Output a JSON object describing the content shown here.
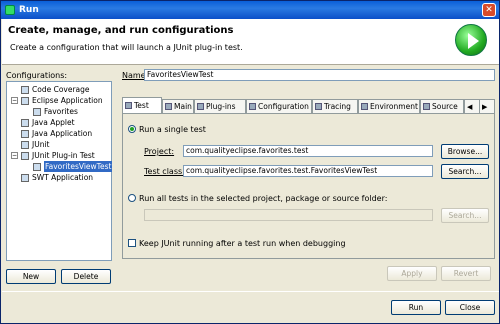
{
  "window": {
    "title": "Run"
  },
  "banner": {
    "heading": "Create, manage, and run configurations",
    "subtitle": "Create a configuration that will launch a JUnit plug-in test."
  },
  "left": {
    "label": "Configurations:",
    "tree": [
      {
        "label": "Code Coverage",
        "icon": "coverage-icon"
      },
      {
        "label": "Eclipse Application",
        "icon": "eclipse-icon"
      },
      {
        "label": "Favorites",
        "icon": "run-config-icon"
      },
      {
        "label": "Java Applet",
        "icon": "applet-icon"
      },
      {
        "label": "Java Application",
        "icon": "java-app-icon"
      },
      {
        "label": "JUnit",
        "icon": "junit-icon"
      },
      {
        "label": "JUnit Plug-in Test",
        "icon": "junit-plugin-icon"
      },
      {
        "label": "FavoritesViewTest",
        "icon": "junit-test-icon"
      },
      {
        "label": "SWT Application",
        "icon": "swt-icon"
      }
    ],
    "new_button": "New",
    "delete_button": "Delete"
  },
  "name": {
    "label": "Name:",
    "value": "FavoritesViewTest"
  },
  "tabs": [
    "Test",
    "Main",
    "Plug-ins",
    "Configuration",
    "Tracing",
    "Environment",
    "Source"
  ],
  "test": {
    "run_single": "Run a single test",
    "project_label": "Project:",
    "project_value": "com.qualityeclipse.favorites.test",
    "browse": "Browse...",
    "class_label": "Test class:",
    "class_value": "com.qualityeclipse.favorites.test.FavoritesViewTest",
    "search": "Search...",
    "run_all": "Run all tests in the selected project, package or source folder:",
    "search2": "Search...",
    "keep_running": "Keep JUnit running after a test run when debugging"
  },
  "actions": {
    "apply": "Apply",
    "revert": "Revert",
    "run": "Run",
    "close": "Close"
  }
}
